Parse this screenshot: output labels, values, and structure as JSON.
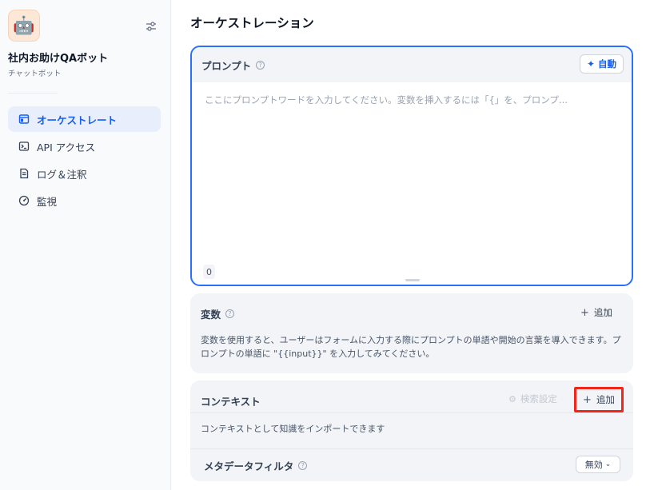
{
  "app": {
    "name": "社内お助けQAボット",
    "type": "チャットボット",
    "icon": "robot-emoji"
  },
  "sidebar": {
    "items": [
      {
        "label": "オーケストレート",
        "icon": "layout-icon",
        "active": true
      },
      {
        "label": "API アクセス",
        "icon": "terminal-icon",
        "active": false
      },
      {
        "label": "ログ＆注釈",
        "icon": "document-icon",
        "active": false
      },
      {
        "label": "監視",
        "icon": "gauge-icon",
        "active": false
      }
    ]
  },
  "page": {
    "title": "オーケストレーション"
  },
  "prompt": {
    "title": "プロンプト",
    "auto_label": "自動",
    "placeholder": "ここにプロンプトワードを入力してください。変数を挿入するには「{」を、プロンプ...",
    "value": "",
    "char_count": "0"
  },
  "variables": {
    "title": "変数",
    "add_label": "追加",
    "description": "変数を使用すると、ユーザーはフォームに入力する際にプロンプトの単語や開始の言葉を導入できます。プロンプトの単語に \"{{input}}\" を入力してみてください。"
  },
  "context": {
    "title": "コンテキスト",
    "retrieval_label": "検索設定",
    "add_label": "追加",
    "description": "コンテキストとして知識をインポートできます",
    "metadata_filter": {
      "label": "メタデータフィルタ",
      "value": "無効"
    }
  },
  "colors": {
    "accent": "#155eef",
    "highlight_outline": "#f0261a"
  }
}
